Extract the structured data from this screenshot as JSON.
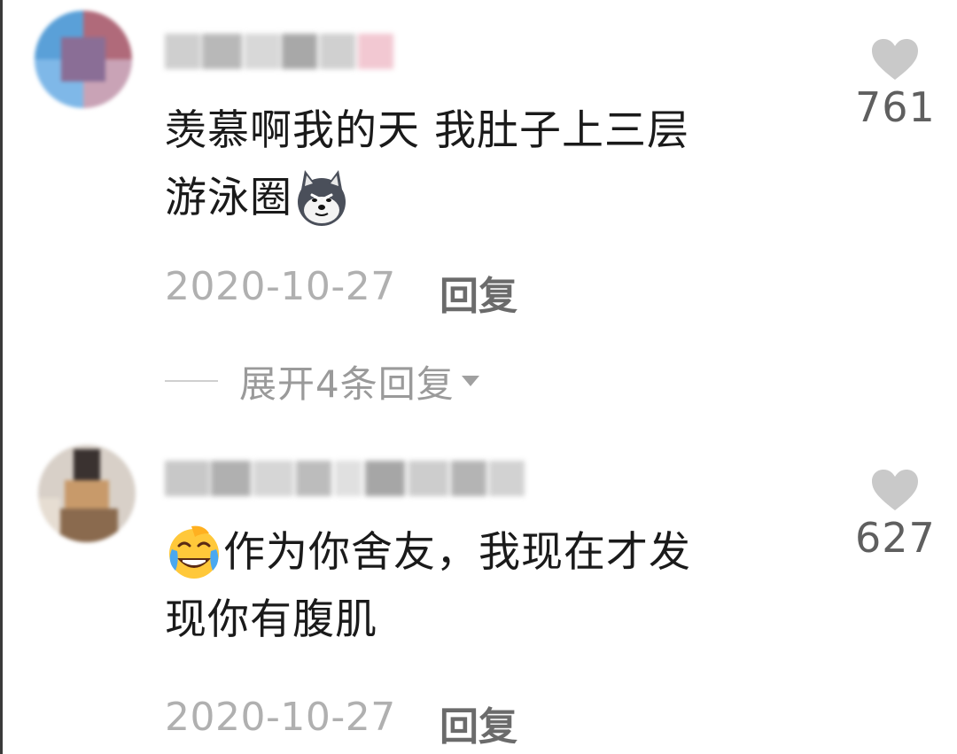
{
  "comments": [
    {
      "text_line1": "羡慕啊我的天 我肚子上三层",
      "text_line2": "游泳圈",
      "emoji": "husky-dog-emoji",
      "date": "2020-10-27",
      "reply_label": "回复",
      "likes": "761",
      "expand_replies_label": "展开4条回复"
    },
    {
      "text_line1": "作为你舍友，我现在才发",
      "text_line2": "现你有腹肌",
      "emoji": "laughing-crying-emoji",
      "date": "2020-10-27",
      "reply_label": "回复",
      "likes": "627"
    }
  ],
  "colors": {
    "text": "#1a1a1a",
    "date": "#b0b0b0",
    "reply": "#6b6b6b",
    "heart": "#c9c9c9",
    "like_count": "#5f5f5f"
  }
}
